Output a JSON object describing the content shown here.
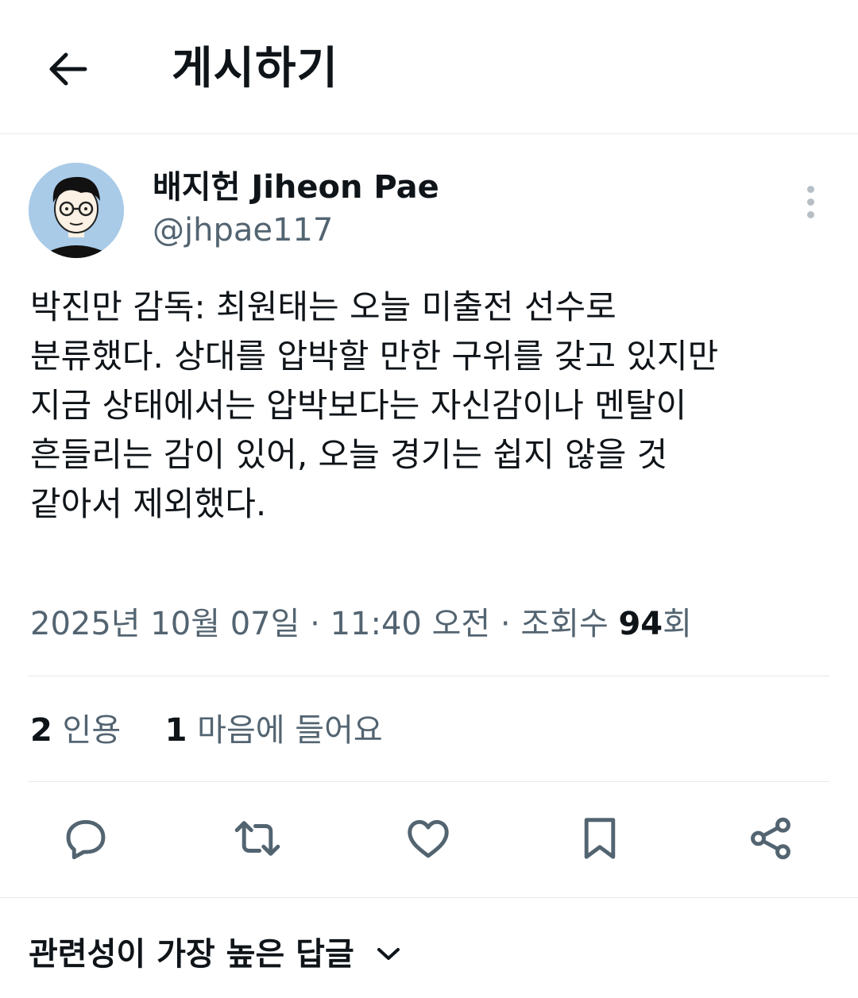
{
  "header": {
    "title": "게시하기",
    "back_icon": "arrow-left-icon"
  },
  "author": {
    "name": "배지헌 Jiheon Pae",
    "handle": "@jhpae117",
    "avatar_icon": "cartoon-avatar"
  },
  "tweet": {
    "lines": [
      "박진만 감독: 최원태는 오늘 미출전 선수로",
      "분류했다. 상대를 압박할 만한 구위를 갖고 있지만",
      "지금 상태에서는 압박보다는 자신감이나 멘탈이",
      "흔들리는 감이 있어, 오늘 경기는 쉽지 않을 것",
      "같아서 제외했다."
    ]
  },
  "meta": {
    "date": "2025년 10월 07일",
    "sep1": " · ",
    "time": "11:40 오전",
    "sep2": " · ",
    "views_label": "조회수 ",
    "views_count": "94",
    "views_suffix": "회"
  },
  "stats": {
    "quotes_count": "2",
    "quotes_label": " 인용",
    "likes_count": "1",
    "likes_label": " 마음에 들어요"
  },
  "actions": [
    "reply-icon",
    "retweet-icon",
    "like-icon",
    "bookmark-icon",
    "share-icon"
  ],
  "replies_sort": {
    "label": "관련성이 가장 높은 답글",
    "icon": "chevron-down-icon"
  },
  "colors": {
    "text": "#0f1419",
    "secondary": "#536471",
    "divider": "#e6e9ec",
    "icon": "#536471"
  }
}
